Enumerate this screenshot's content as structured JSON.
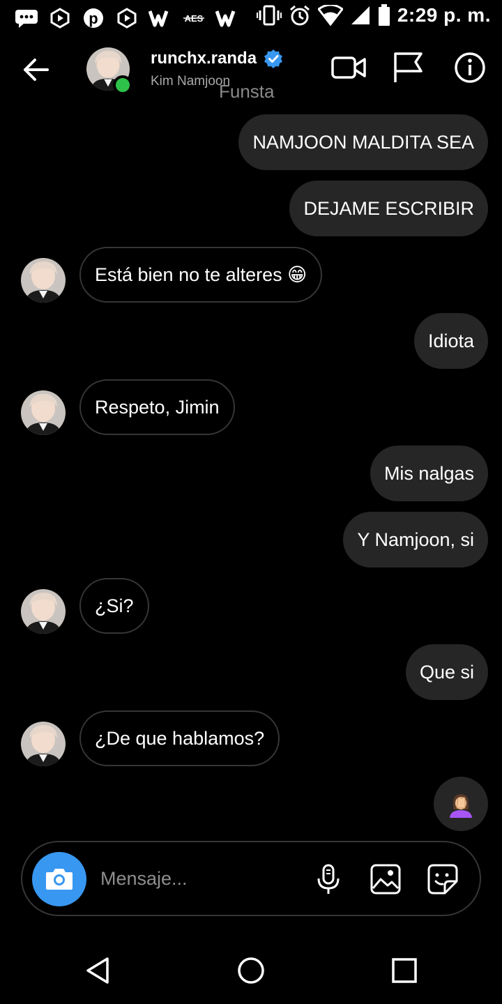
{
  "status_bar": {
    "time": "2:29 p. m.",
    "app_icons": [
      "messages-icon",
      "play-hex-icon",
      "pinterest-icon",
      "play-hex-icon",
      "wattpad-icon",
      "aes-icon",
      "wattpad-icon"
    ],
    "system_icons": [
      "vibrate-icon",
      "alarm-icon",
      "wifi-icon",
      "signal-icon",
      "battery-icon"
    ],
    "aes_label": "AES"
  },
  "header": {
    "username": "runchx.randa",
    "subtitle": "Kim Namjoon",
    "extra_label": "Funsta",
    "verified_color": "#3897f0",
    "online_color": "#2ec24a",
    "actions": [
      "video-call-icon",
      "flag-icon",
      "info-icon"
    ]
  },
  "messages": [
    {
      "from": "me",
      "text": "NAMJOON MALDITA SEA"
    },
    {
      "from": "me",
      "text": "DEJAME ESCRIBIR"
    },
    {
      "from": "them",
      "text": "Está bien no te alteres 😁"
    },
    {
      "from": "me",
      "text": "Idiota"
    },
    {
      "from": "them",
      "text": "Respeto, Jimin"
    },
    {
      "from": "me",
      "text": "Mis nalgas"
    },
    {
      "from": "me",
      "text": "Y Namjoon, si"
    },
    {
      "from": "them",
      "text": "¿Si?"
    },
    {
      "from": "me",
      "text": "Que si"
    },
    {
      "from": "them",
      "text": "¿De que hablamos?"
    },
    {
      "from": "me",
      "text": "🤦‍♀️"
    }
  ],
  "composer": {
    "placeholder": "Mensaje...",
    "camera_color": "#3897f0",
    "icons": [
      "camera-icon",
      "microphone-icon",
      "gallery-icon",
      "sticker-icon"
    ]
  },
  "nav_bar": {
    "buttons": [
      "back-triangle-icon",
      "home-circle-icon",
      "recents-square-icon"
    ]
  },
  "colors": {
    "background": "#000000",
    "sent_bubble": "#262626",
    "received_border": "#363636",
    "subtitle_text": "#a8a8a8"
  }
}
